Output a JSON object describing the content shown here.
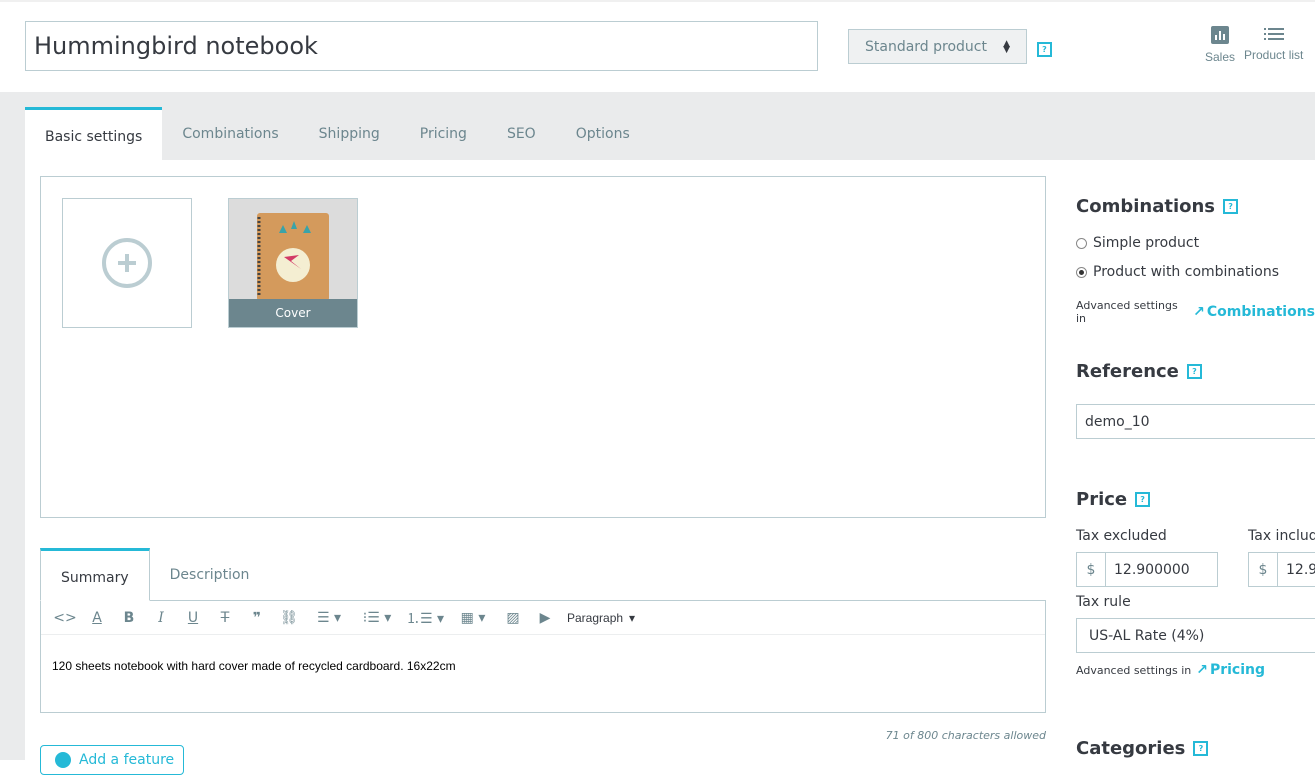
{
  "header": {
    "product_name": "Hummingbird notebook",
    "product_type": "Standard product",
    "help": "?",
    "sales_label": "Sales",
    "product_list_label": "Product list"
  },
  "tabs": [
    {
      "label": "Basic settings",
      "active": true
    },
    {
      "label": "Combinations"
    },
    {
      "label": "Shipping"
    },
    {
      "label": "Pricing"
    },
    {
      "label": "SEO"
    },
    {
      "label": "Options"
    }
  ],
  "images": {
    "cover_label": "Cover"
  },
  "description": {
    "tabs": [
      "Summary",
      "Description"
    ],
    "paragraph_format": "Paragraph",
    "summary_text": "120 sheets notebook with hard cover made of recycled cardboard. 16x22cm",
    "char_count": "71 of 800 characters allowed",
    "add_feature_label": "Add a feature"
  },
  "sidebar": {
    "combinations": {
      "title": "Combinations",
      "options": [
        "Simple product",
        "Product with combinations"
      ],
      "selected": 1,
      "advanced_prefix": "Advanced settings in",
      "advanced_link": "Combinations"
    },
    "reference": {
      "title": "Reference",
      "value": "demo_10"
    },
    "price": {
      "title": "Price",
      "tax_excluded_label": "Tax excluded",
      "tax_included_label": "Tax includ",
      "currency": "$",
      "tax_excluded_value": "12.900000",
      "tax_included_value": "12.9",
      "tax_rule_label": "Tax rule",
      "tax_rule_value": "US-AL Rate (4%)",
      "advanced_prefix": "Advanced settings in",
      "advanced_link": "Pricing"
    },
    "categories": {
      "title": "Categories"
    }
  },
  "colors": {
    "accent": "#25b9d7",
    "border": "#bbcdd2",
    "muted": "#6c868e",
    "band": "#eaebec"
  }
}
